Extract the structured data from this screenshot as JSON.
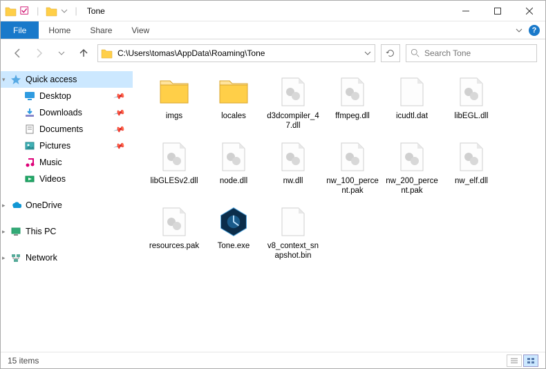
{
  "window": {
    "title": "Tone"
  },
  "ribbon": {
    "file": "File",
    "tabs": [
      "Home",
      "Share",
      "View"
    ]
  },
  "nav": {
    "path": "C:\\Users\\tomas\\AppData\\Roaming\\Tone",
    "search_placeholder": "Search Tone"
  },
  "sidebar": {
    "quick": {
      "label": "Quick access",
      "items": [
        {
          "label": "Desktop",
          "icon": "desktop",
          "pinned": true
        },
        {
          "label": "Downloads",
          "icon": "downloads",
          "pinned": true
        },
        {
          "label": "Documents",
          "icon": "documents",
          "pinned": true
        },
        {
          "label": "Pictures",
          "icon": "pictures",
          "pinned": true
        },
        {
          "label": "Music",
          "icon": "music",
          "pinned": false
        },
        {
          "label": "Videos",
          "icon": "videos",
          "pinned": false
        }
      ]
    },
    "onedrive": {
      "label": "OneDrive"
    },
    "thispc": {
      "label": "This PC"
    },
    "network": {
      "label": "Network"
    }
  },
  "files": [
    {
      "name": "imgs",
      "type": "folder"
    },
    {
      "name": "locales",
      "type": "folder"
    },
    {
      "name": "d3dcompiler_47.dll",
      "type": "dll"
    },
    {
      "name": "ffmpeg.dll",
      "type": "dll"
    },
    {
      "name": "icudtl.dat",
      "type": "dat"
    },
    {
      "name": "libEGL.dll",
      "type": "dll"
    },
    {
      "name": "libGLESv2.dll",
      "type": "dll"
    },
    {
      "name": "node.dll",
      "type": "dll"
    },
    {
      "name": "nw.dll",
      "type": "dll"
    },
    {
      "name": "nw_100_percent.pak",
      "type": "pak"
    },
    {
      "name": "nw_200_percent.pak",
      "type": "pak"
    },
    {
      "name": "nw_elf.dll",
      "type": "dll"
    },
    {
      "name": "resources.pak",
      "type": "pak"
    },
    {
      "name": "Tone.exe",
      "type": "exe"
    },
    {
      "name": "v8_context_snapshot.bin",
      "type": "bin"
    }
  ],
  "status": {
    "count": "15 items"
  }
}
